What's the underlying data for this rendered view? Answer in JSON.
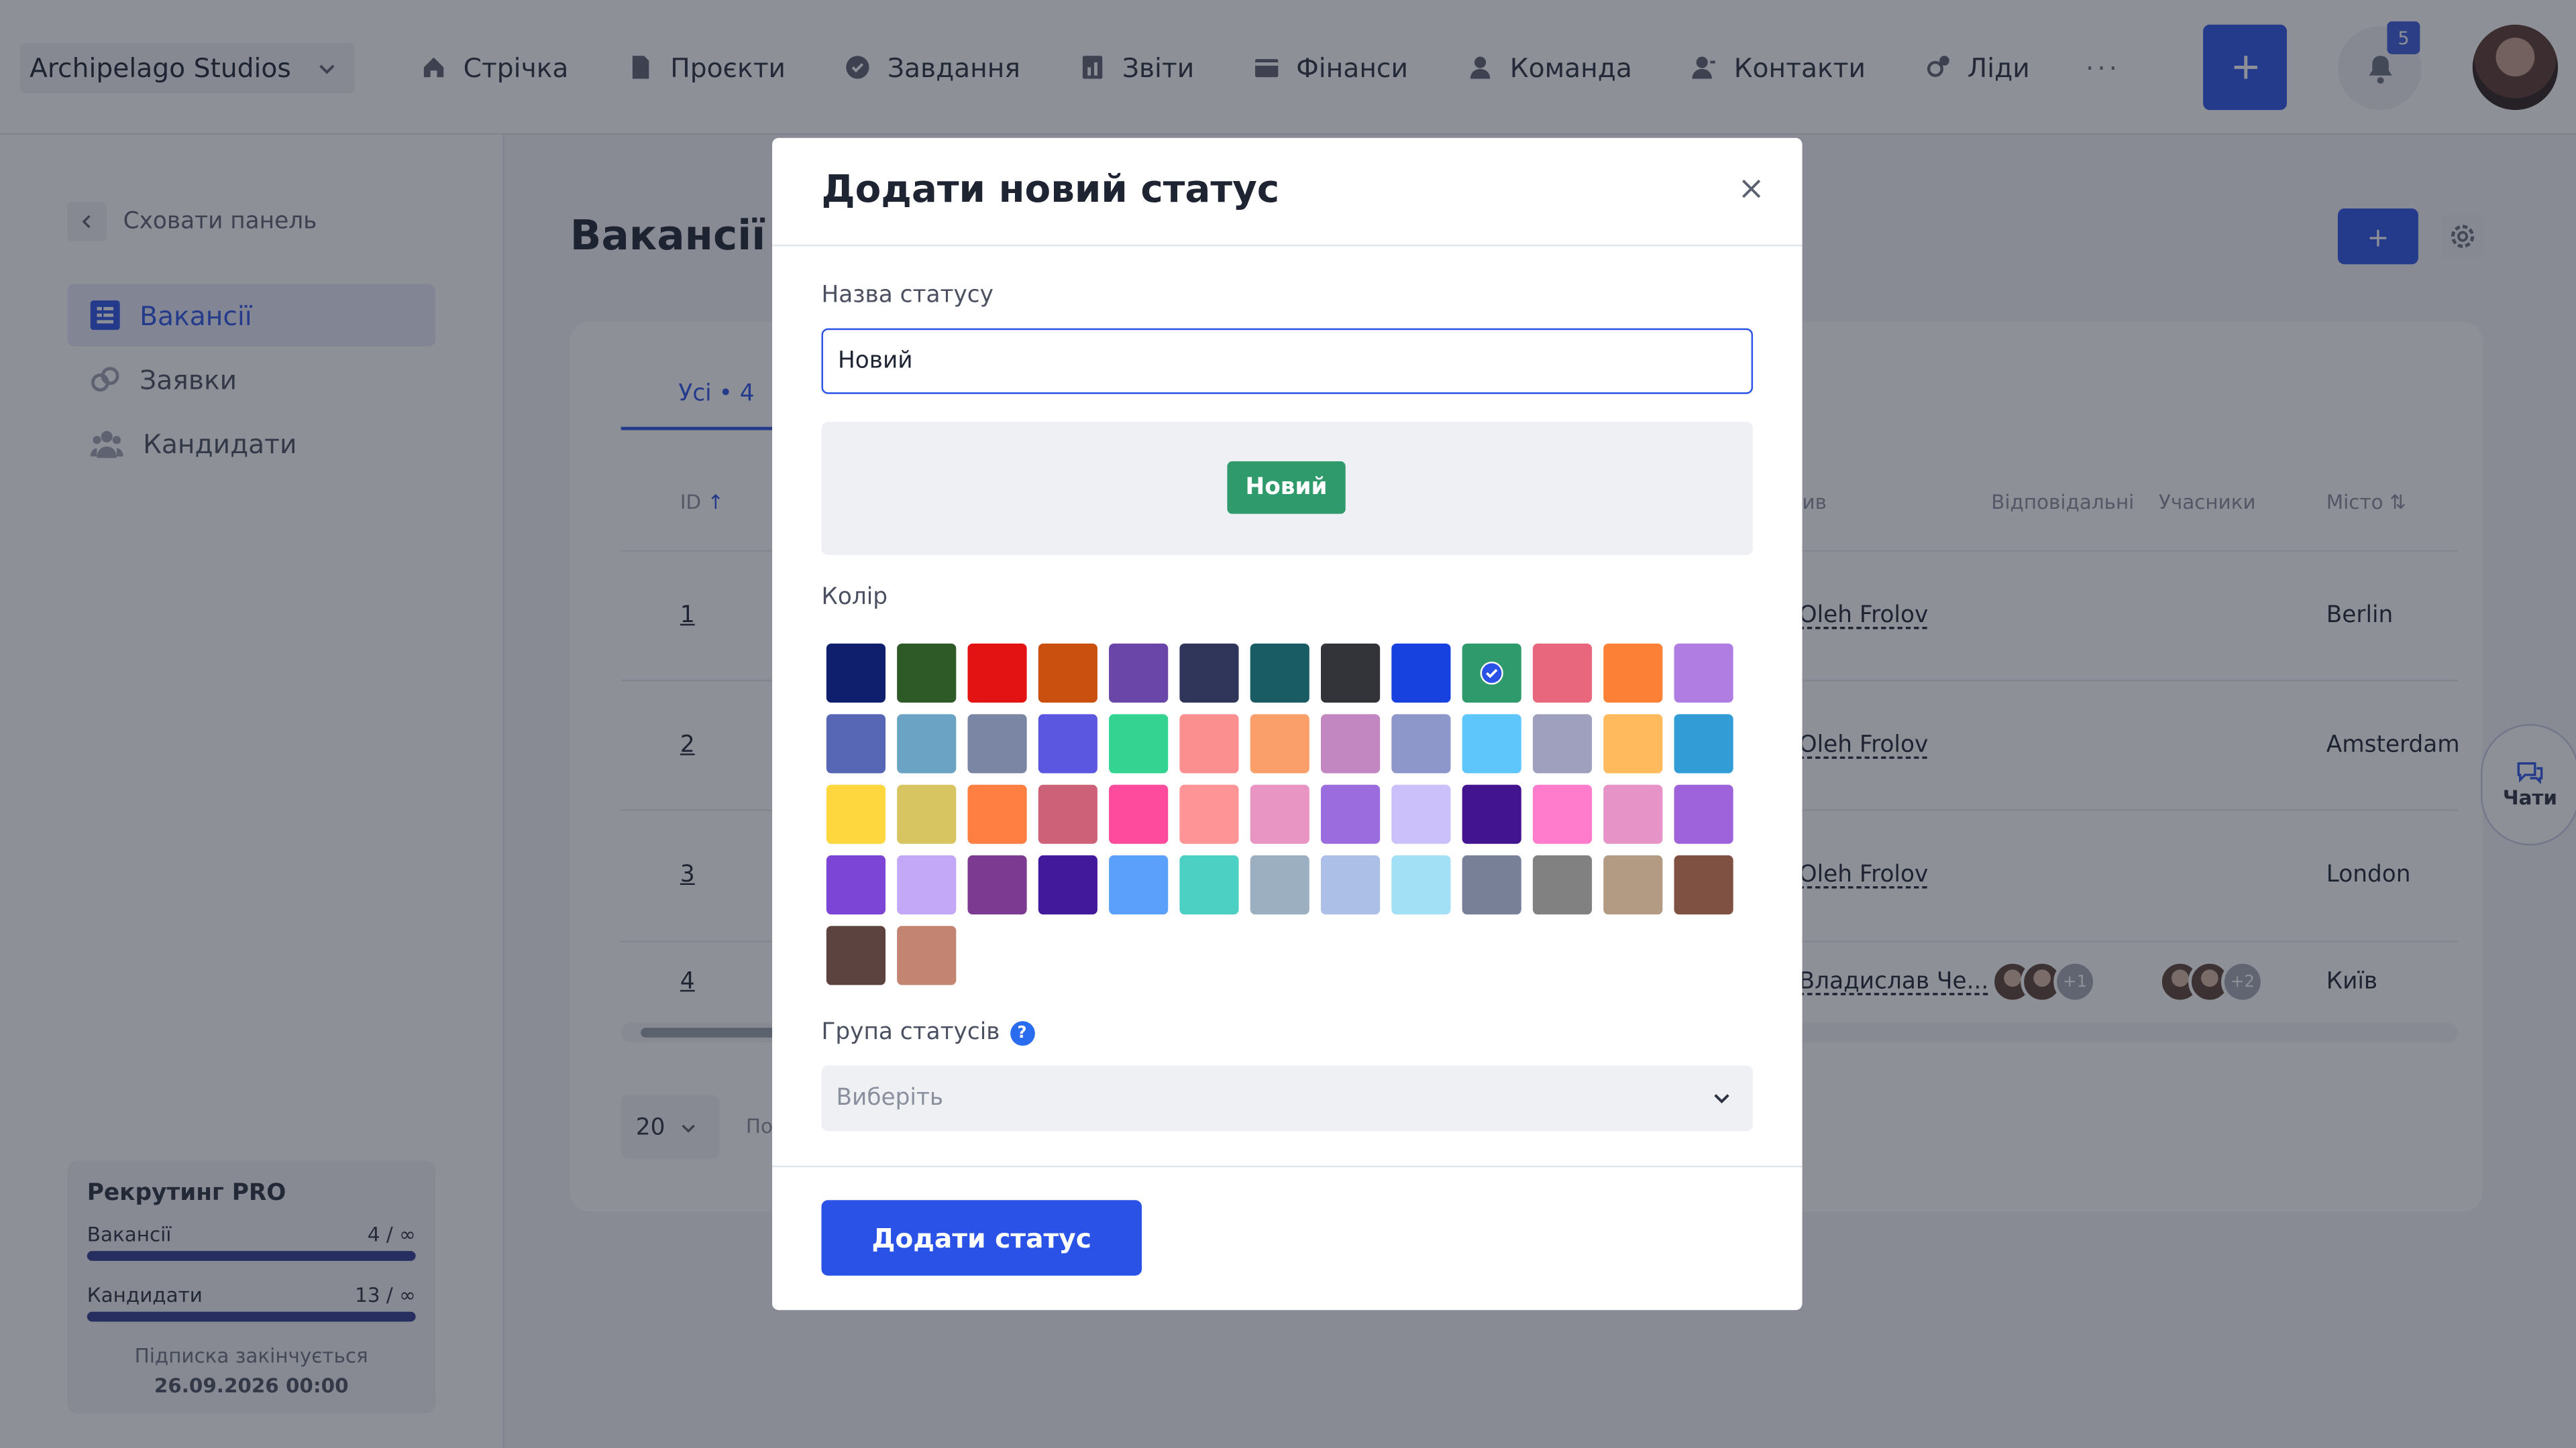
{
  "company": "Archipelago Studios",
  "nav": [
    "Стрічка",
    "Проєкти",
    "Завдання",
    "Звіти",
    "Фінанси",
    "Команда",
    "Контакти",
    "Ліди"
  ],
  "nav_more": "···",
  "notifications_count": "5",
  "sidebar": {
    "hide_label": "Сховати панель",
    "items": [
      "Вакансії",
      "Заявки",
      "Кандидати"
    ],
    "plan": {
      "title": "Рекрутинг PRO",
      "vacancies_label": "Вакансії",
      "vacancies_value": "4 / ∞",
      "candidates_label": "Кандидати",
      "candidates_value": "13 / ∞",
      "expires_label": "Підписка закінчується",
      "expires_date": "26.09.2026 00:00"
    }
  },
  "page": {
    "title": "Вакансії",
    "add_label": "+",
    "tab_all": "Усі • 4",
    "columns": {
      "id": "ID",
      "created": "ив",
      "responsible": "Відповідальні",
      "participants": "Учасники",
      "city": "Місто"
    },
    "rows": [
      {
        "id": "1",
        "responsible": "Oleh Frolov",
        "city": "Berlin"
      },
      {
        "id": "2",
        "responsible": "Oleh Frolov",
        "city": "Amsterdam"
      },
      {
        "id": "3",
        "responsible": "Oleh Frolov",
        "city": "London"
      },
      {
        "id": "4",
        "responsible": "Владислав Че...",
        "city": "Київ",
        "resp_more": "+1",
        "part_more": "+2"
      }
    ],
    "per_page": "20",
    "pagination_hint": "По",
    "chats_label": "Чати"
  },
  "modal": {
    "title": "Додати новий статус",
    "name_label": "Назва статусу",
    "name_value": "Новий",
    "preview_text": "Новий",
    "preview_color": "#2f9a6c",
    "color_label": "Колір",
    "selected_color_index": 9,
    "colors": [
      "#0f1f6e",
      "#2e5a27",
      "#e31313",
      "#c9500f",
      "#6a46a9",
      "#2f365a",
      "#1a5c63",
      "#33333a",
      "#1742df",
      "#2f9a6c",
      "#e8677c",
      "#fc8036",
      "#b07de2",
      "#5866b6",
      "#6aa3c3",
      "#7b86a5",
      "#5b57e0",
      "#34d392",
      "#fb8f8f",
      "#fa9f6a",
      "#c286c1",
      "#8e97ca",
      "#5fc6fb",
      "#9ea0bd",
      "#ffba5e",
      "#329cd6",
      "#fdd73d",
      "#d6c560",
      "#ff7e42",
      "#cc6177",
      "#ff4b9e",
      "#ff9496",
      "#e895c4",
      "#9b6cde",
      "#cbc0fa",
      "#43148f",
      "#ff7bcc",
      "#e693c7",
      "#9e62db",
      "#7d45d5",
      "#c2a8f7",
      "#7c3b90",
      "#42199b",
      "#5ba0fb",
      "#4cd0c3",
      "#9bafc0",
      "#abbfe7",
      "#a2e0f6",
      "#778096",
      "#818181",
      "#b29b82",
      "#7e5142",
      "#5c4340",
      "#c48472"
    ],
    "group_label": "Група статусів",
    "group_help": "?",
    "group_placeholder": "Виберіть",
    "submit_label": "Додати статус"
  }
}
